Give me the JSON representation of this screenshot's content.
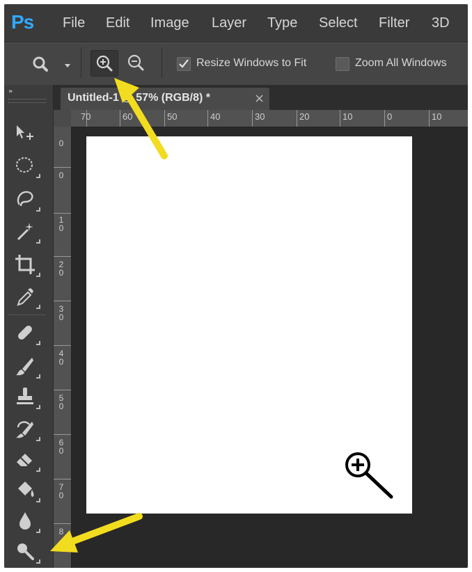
{
  "app": {
    "logo": "Ps"
  },
  "menu": [
    "File",
    "Edit",
    "Image",
    "Layer",
    "Type",
    "Select",
    "Filter",
    "3D"
  ],
  "options": {
    "resize_label": "Resize Windows to Fit",
    "resize_checked": true,
    "zoom_all_label": "Zoom All Windows",
    "zoom_all_checked": false
  },
  "tab": {
    "title": "Untitled-1 @ 57% (RGB/8) *",
    "close": "×"
  },
  "ruler_top": [
    "70",
    "60",
    "50",
    "40",
    "30",
    "20",
    "10",
    "0",
    "10"
  ],
  "ruler_left": [
    "0",
    "0",
    "10",
    "20",
    "30",
    "40",
    "50",
    "60",
    "70",
    "8"
  ],
  "tools": [
    "move-tool",
    "elliptical-marquee-tool",
    "lasso-tool",
    "magic-wand-tool",
    "crop-tool",
    "eyedropper-tool",
    "healing-brush-tool",
    "brush-tool",
    "clone-stamp-tool",
    "history-brush-tool",
    "eraser-tool",
    "paint-bucket-tool",
    "blur-tool",
    "zoom-tool"
  ],
  "colors": {
    "accent": "#31a8ff",
    "arrow": "#f2dc1f",
    "panel": "#3c3c3c",
    "background": "#2b2b2b"
  }
}
